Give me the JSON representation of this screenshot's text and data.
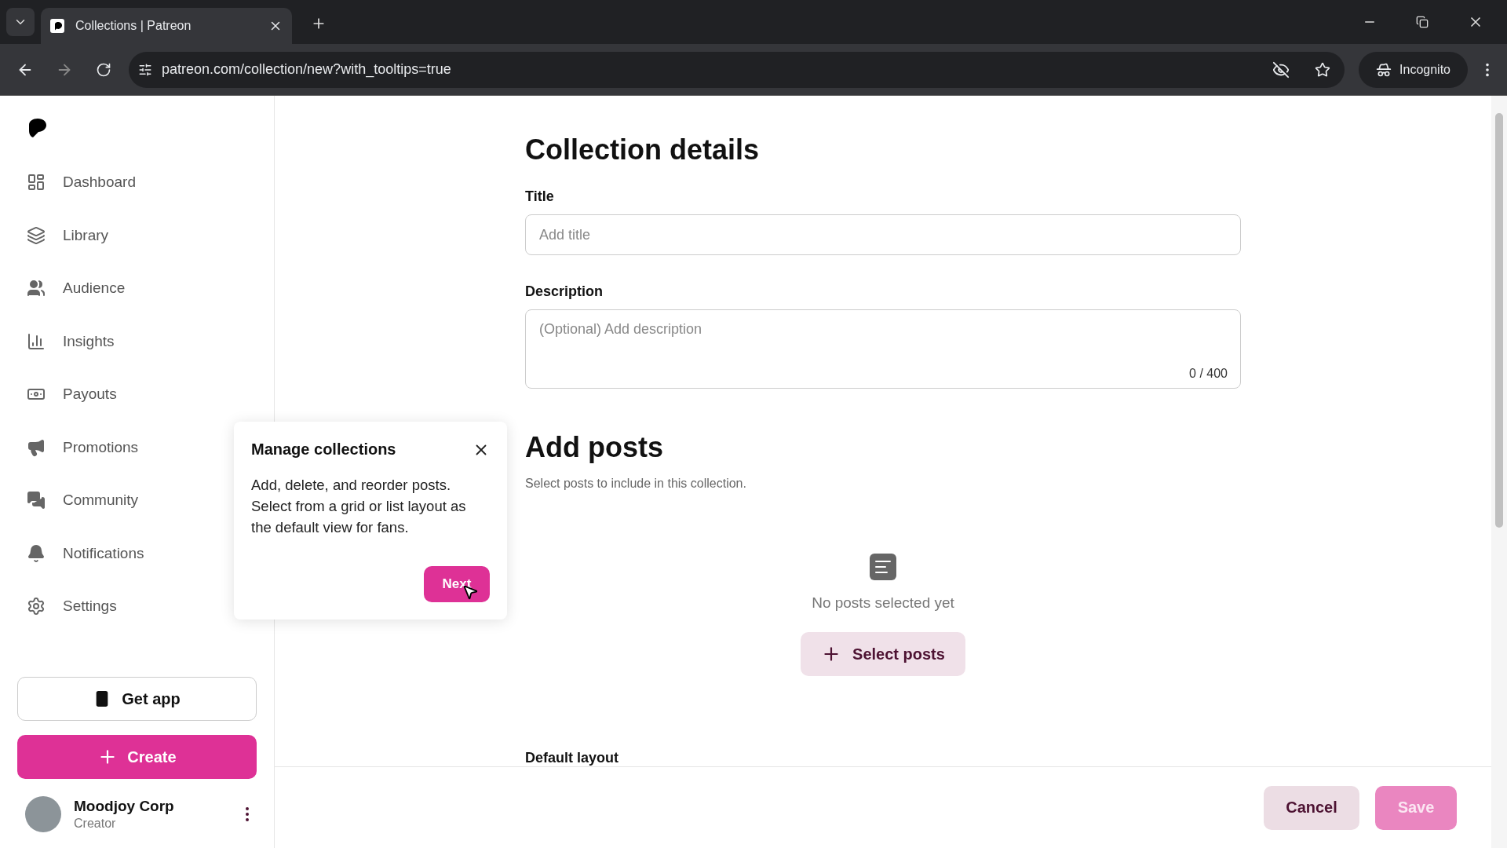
{
  "browser": {
    "tab_title": "Collections | Patreon",
    "url": "patreon.com/collection/new?with_tooltips=true",
    "profile_label": "Incognito"
  },
  "sidebar": {
    "items": [
      {
        "label": "Dashboard",
        "selected": false
      },
      {
        "label": "Library",
        "selected": false
      },
      {
        "label": "Audience",
        "selected": false
      },
      {
        "label": "Insights",
        "selected": false
      },
      {
        "label": "Payouts",
        "selected": false
      },
      {
        "label": "Promotions",
        "selected": false
      },
      {
        "label": "Community",
        "selected": false
      },
      {
        "label": "Notifications",
        "selected": false
      },
      {
        "label": "Settings",
        "selected": false
      }
    ],
    "get_app_label": "Get app",
    "create_label": "Create",
    "user": {
      "name": "Moodjoy Corp",
      "role": "Creator"
    }
  },
  "form": {
    "heading": "Collection details",
    "title_label": "Title",
    "title_placeholder": "Add title",
    "description_label": "Description",
    "description_placeholder": "(Optional) Add description",
    "description_count": "0 / 400",
    "posts_heading": "Add posts",
    "posts_subtitle": "Select posts to include in this collection.",
    "empty_text": "No posts selected yet",
    "select_label": "Select posts",
    "default_layout_label": "Default layout"
  },
  "tooltip": {
    "title": "Manage collections",
    "body": "Add, delete, and reorder posts. Select from a grid or list layout as the default view for fans.",
    "next_label": "Next"
  },
  "footer": {
    "cancel_label": "Cancel",
    "save_label": "Save",
    "save_disabled": true
  }
}
